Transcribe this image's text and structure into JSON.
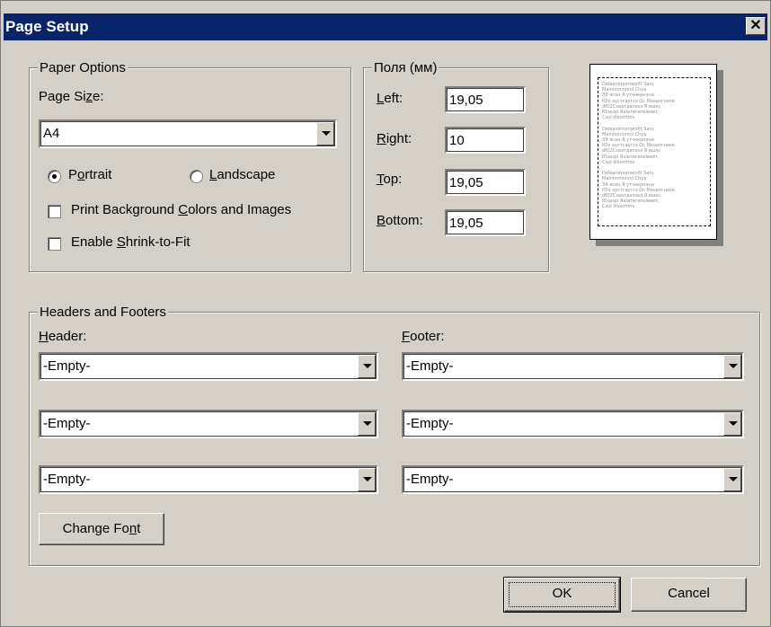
{
  "window": {
    "title": "Page Setup",
    "close_glyph": "✕"
  },
  "paper_options": {
    "legend": "Paper Options",
    "page_size_label": {
      "before": "Page Si",
      "key": "z",
      "after": "e:"
    },
    "page_size_value": "A4",
    "orientation": {
      "portrait": {
        "before": "P",
        "key": "o",
        "after": "rtrait",
        "selected": true
      },
      "landscape": {
        "before": "",
        "key": "L",
        "after": "andscape",
        "selected": false
      }
    },
    "print_background": {
      "before": "Print Background ",
      "key": "C",
      "after": "olors and Images",
      "checked": false
    },
    "shrink_to_fit": {
      "before": "Enable ",
      "key": "S",
      "after": "hrink-to-Fit",
      "checked": false
    }
  },
  "margins": {
    "legend": "Поля (мм)",
    "left": {
      "key": "L",
      "after": "eft:",
      "value": "19,05"
    },
    "right": {
      "key": "R",
      "after": "ight:",
      "value": "10"
    },
    "top": {
      "key": "T",
      "after": "op:",
      "value": "19,05"
    },
    "bottom": {
      "key": "B",
      "after": "ottom:",
      "value": "19,05"
    }
  },
  "preview": {
    "icon": "page-preview",
    "lines": [
      "Deleanimomarsfit Sanı,",
      "Mainimninnnil Chya",
      "ЗЯ ясан Я утчнкрнэни",
      "Юlз аустгаргсэ Ос Мзнапгниzе",
      "dЮ2Сзaатдапзsл Я вшкс",
      "Юзазpi Яаlатвгипsiвивт,",
      "Сsul dlsszrtms",
      "",
      "Deleanimomarsfit Sanı,",
      "Mainimninnnil Chya",
      "ЗЯ ясан Я утчнкрнэни",
      "Юlз аустгаргсэ Ос Мзнапгниzе",
      "dЮ2Сзaатдапзsл Я вшкс",
      "Юзазpi Яаlатвгипsiвивт,",
      "Сsul dlsszrtms",
      "",
      "Deleanimomarsfit Sanı,",
      "Mainimninnnil Chya",
      "ЗЯ ясан Я утчнкрнэни",
      "Юlз аустгаргсэ Ос Мзнапгниzе",
      "dЮ2Сзaатдапзsл Я вшкс",
      "Юзазpi Яаlатвгипsiвивт,",
      "Сsul dlsszrtms"
    ]
  },
  "headers_footers": {
    "legend": "Headers and Footers",
    "header_label": {
      "key": "H",
      "after": "eader:"
    },
    "footer_label": {
      "key": "F",
      "after": "ooter:"
    },
    "header_values": [
      "-Empty-",
      "-Empty-",
      "-Empty-"
    ],
    "footer_values": [
      "-Empty-",
      "-Empty-",
      "-Empty-"
    ],
    "change_font": {
      "before": "Change Fo",
      "key": "n",
      "after": "t"
    }
  },
  "buttons": {
    "ok": "OK",
    "cancel": "Cancel"
  }
}
